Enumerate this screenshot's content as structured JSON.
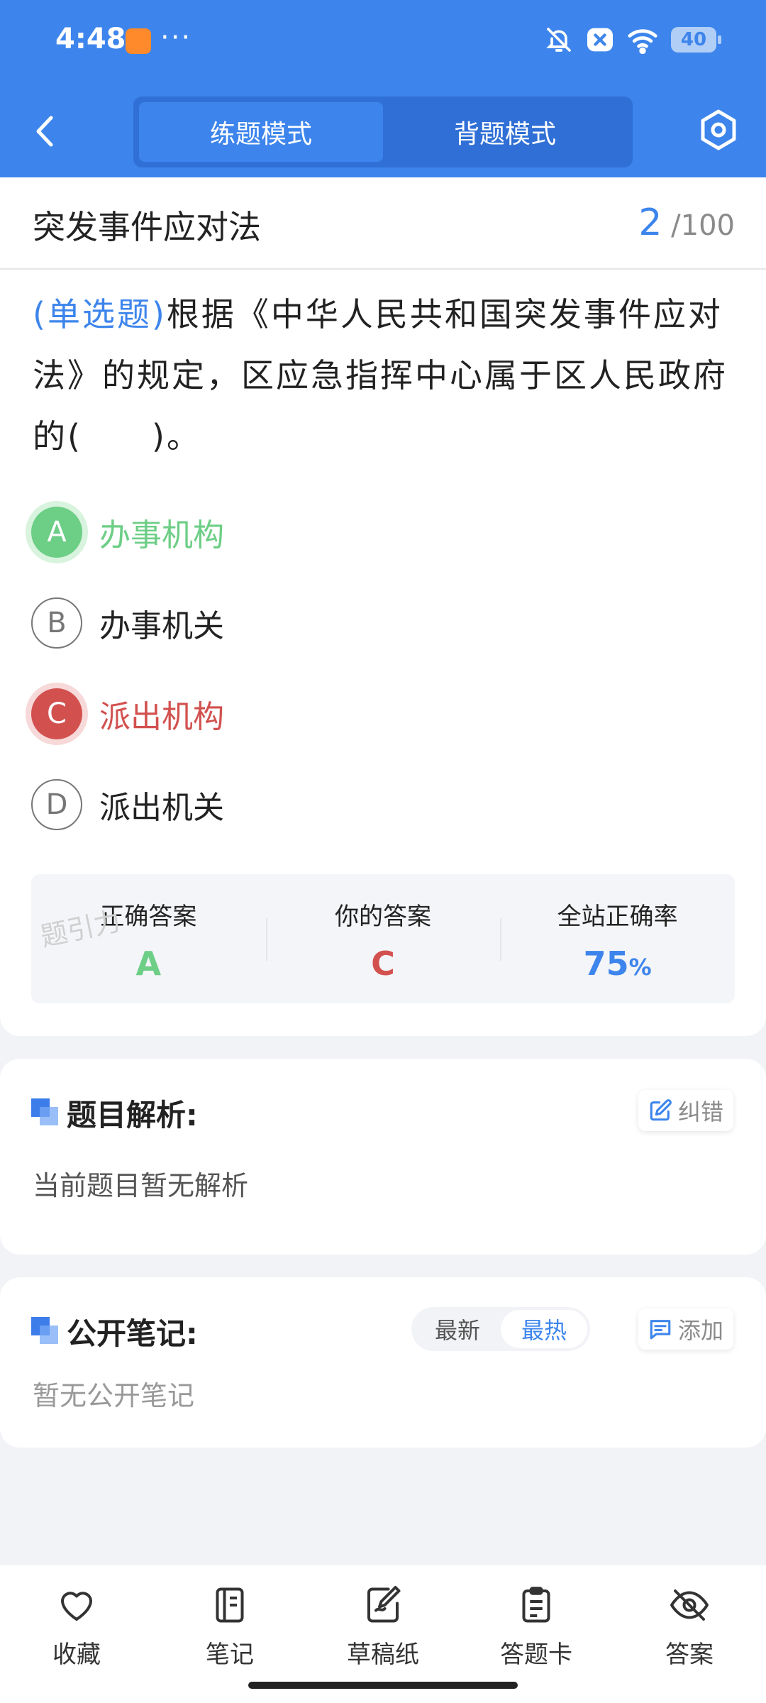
{
  "status_bar": {
    "time": "4:48",
    "battery": "40"
  },
  "header": {
    "tabs": [
      {
        "label": "练题模式",
        "active": true
      },
      {
        "label": "背题模式",
        "active": false
      }
    ]
  },
  "subject": {
    "title": "突发事件应对法",
    "current": "2",
    "total": "/100"
  },
  "question": {
    "type": "(单选题)",
    "text": "根据《中华人民共和国突发事件应对法》的规定，区应急指挥中心属于区人民政府的(　　)。"
  },
  "options": [
    {
      "key": "A",
      "text": "办事机构",
      "state": "right"
    },
    {
      "key": "B",
      "text": "办事机关",
      "state": "plain"
    },
    {
      "key": "C",
      "text": "派出机构",
      "state": "wrong"
    },
    {
      "key": "D",
      "text": "派出机关",
      "state": "plain"
    }
  ],
  "answer_summary": {
    "correct_label": "正确答案",
    "correct_value": "A",
    "yours_label": "你的答案",
    "yours_value": "C",
    "rate_label": "全站正确率",
    "rate_value": "75",
    "rate_unit": "%",
    "watermark": "题引力"
  },
  "analysis": {
    "title": "题目解析:",
    "correct_btn": "纠错",
    "body": "当前题目暂无解析"
  },
  "notes": {
    "title": "公开笔记:",
    "sort_new": "最新",
    "sort_hot": "最热",
    "add_btn": "添加",
    "body": "暂无公开笔记"
  },
  "bottom_nav": [
    {
      "label": "收藏",
      "icon": "heart-icon"
    },
    {
      "label": "笔记",
      "icon": "notebook-icon"
    },
    {
      "label": "草稿纸",
      "icon": "draft-paper-icon"
    },
    {
      "label": "答题卡",
      "icon": "answer-card-icon"
    },
    {
      "label": "答案",
      "icon": "eye-off-icon"
    }
  ],
  "colors": {
    "primary": "#3d85ec",
    "correct": "#6dce86",
    "wrong": "#d2514f"
  }
}
